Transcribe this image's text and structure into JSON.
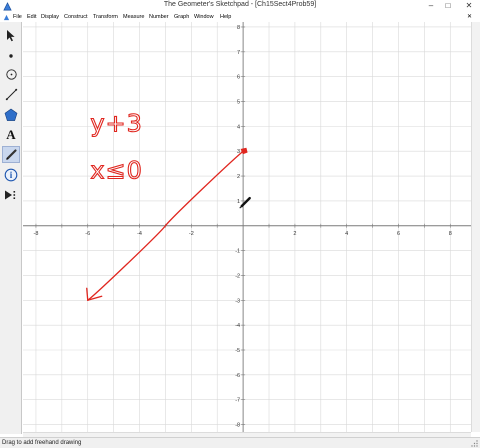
{
  "window": {
    "title": "The Geometer's Sketchpad - [Ch15Sect4Prob59]",
    "controls": [
      "minimize",
      "maximize",
      "close"
    ]
  },
  "menu": {
    "items": [
      "File",
      "Edit",
      "Display",
      "Construct",
      "Transform",
      "Measure",
      "Number",
      "Graph",
      "Window",
      "Help"
    ]
  },
  "toolbox": {
    "tools": [
      {
        "name": "arrow-selection-tool",
        "icon": "arrow-icon"
      },
      {
        "name": "point-tool",
        "icon": "point-icon"
      },
      {
        "name": "compass-tool",
        "icon": "compass-circle-icon"
      },
      {
        "name": "straightedge-tool",
        "icon": "line-segment-icon"
      },
      {
        "name": "polygon-tool",
        "icon": "polygon-icon"
      },
      {
        "name": "text-tool",
        "icon": "text-a-icon"
      },
      {
        "name": "marker-tool",
        "icon": "marker-pen-icon",
        "active": true
      },
      {
        "name": "information-tool",
        "icon": "info-icon"
      },
      {
        "name": "custom-tool",
        "icon": "custom-tool-arrow-icon"
      }
    ],
    "text_tool_glyph": "A",
    "info_glyph": "i"
  },
  "graph": {
    "x_ticks": [
      "-8",
      "-6",
      "-4",
      "-2",
      "2",
      "4",
      "6",
      "8"
    ],
    "y_ticks": [
      "8",
      "7",
      "6",
      "5",
      "4",
      "3",
      "2",
      "1",
      "-1",
      "-2",
      "-3",
      "-4",
      "-5",
      "-6",
      "-7",
      "-8"
    ],
    "grid": true,
    "x_range": [
      -8.5,
      8.8
    ],
    "y_range": [
      -8.3,
      8.2
    ],
    "handwriting": [
      "y+3",
      "x≤0"
    ],
    "drawn_ray": {
      "from": [
        0,
        3
      ],
      "to": [
        -6,
        -3
      ],
      "color": "#e0261f",
      "arrowhead_at": "end",
      "endpoint_marker_at": "start"
    },
    "colors": {
      "grid": "#d9d9d9",
      "axes": "#7a7a7a",
      "ink": "#e0261f"
    }
  },
  "status": {
    "text": "Drag to add freehand drawing"
  }
}
